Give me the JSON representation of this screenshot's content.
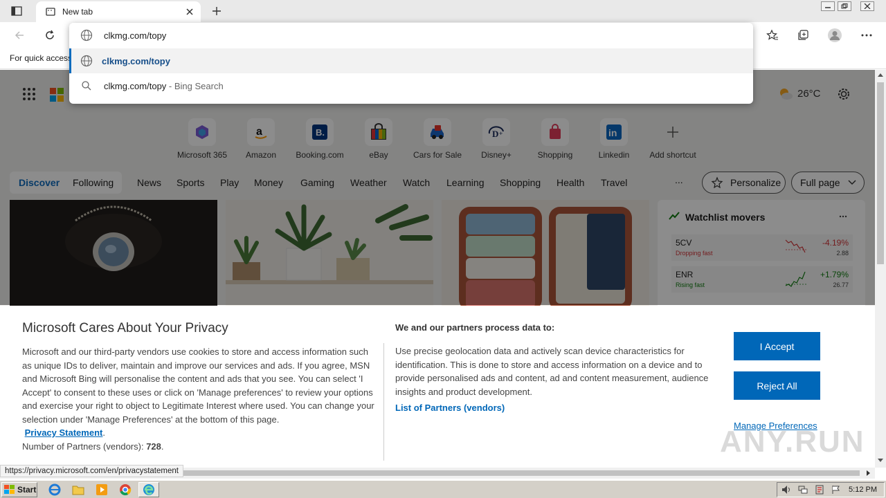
{
  "browser": {
    "tab_title": "New tab",
    "address_value": "clkmg.com/topy",
    "suggestions": [
      {
        "text": "clkmg.com/topy"
      },
      {
        "text": "clkmg.com/topy",
        "suffix": " - Bing Search"
      }
    ],
    "favorites_hint": "For quick access",
    "status_url": "https://privacy.microsoft.com/en/privacystatement"
  },
  "newtab": {
    "weather": "26°C",
    "shortcuts": [
      {
        "label": "Microsoft 365",
        "icon": "microsoft-365-icon"
      },
      {
        "label": "Amazon",
        "icon": "amazon-icon"
      },
      {
        "label": "Booking.com",
        "icon": "booking-icon"
      },
      {
        "label": "eBay",
        "icon": "ebay-icon"
      },
      {
        "label": "Cars for Sale",
        "icon": "car-icon"
      },
      {
        "label": "Disney+",
        "icon": "disney-icon"
      },
      {
        "label": "Shopping",
        "icon": "shopping-bag-icon"
      },
      {
        "label": "Linkedin",
        "icon": "linkedin-icon"
      },
      {
        "label": "Add shortcut",
        "icon": "plus-icon"
      }
    ],
    "feed_toggle": {
      "discover": "Discover",
      "following": "Following"
    },
    "nav": [
      "News",
      "Sports",
      "Play",
      "Money",
      "Gaming",
      "Weather",
      "Watch",
      "Learning",
      "Shopping",
      "Health",
      "Travel"
    ],
    "more": "...",
    "personalize": "Personalize",
    "layout": "Full page",
    "watchlist": {
      "title": "Watchlist movers",
      "stocks": [
        {
          "symbol": "5CV",
          "status": "Dropping fast",
          "change": "-4.19%",
          "price": "2.88",
          "color": "#d13438"
        },
        {
          "symbol": "ENR",
          "status": "Rising fast",
          "change": "+1.79%",
          "price": "26.77",
          "color": "#107c10"
        }
      ]
    }
  },
  "consent": {
    "title": "Microsoft Cares About Your Privacy",
    "body": "Microsoft and our third-party vendors use cookies to store and access information such as unique IDs to deliver, maintain and improve our services and ads. If you agree, MSN and Microsoft Bing will personalise the content and ads that you see. You can select 'I Accept' to consent to these uses or click on 'Manage preferences' to review your options and exercise your right to object to Legitimate Interest where used.  You can change your selection under 'Manage Preferences' at the bottom of this page.",
    "privacy_link": "Privacy Statement",
    "partners_label": "Number of Partners (vendors): ",
    "partners_count": "728",
    "partners_head": "We and our partners process data to:",
    "partners_body": "Use precise geolocation data and actively scan device characteristics for identification. This is done to store and access information on a device and to provide personalised ads and content, ad and content measurement, audience insights and product development.",
    "vendors_link": "List of Partners (vendors)",
    "accept": "I Accept",
    "reject": "Reject All",
    "manage": "Manage Preferences"
  },
  "watermark": "ANY.RUN",
  "taskbar": {
    "start": "Start",
    "clock": "5:12 PM"
  }
}
